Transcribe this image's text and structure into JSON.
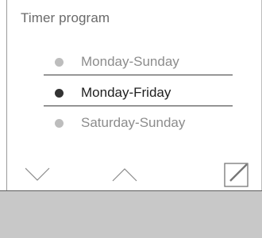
{
  "screen": {
    "title": "Timer program"
  },
  "options": [
    {
      "label": "Monday-Sunday",
      "selected": false
    },
    {
      "label": "Monday-Friday",
      "selected": true
    },
    {
      "label": "Saturday-Sunday",
      "selected": false
    }
  ],
  "controls": {
    "down_icon": "chevron-down-icon",
    "up_icon": "chevron-up-icon",
    "edit_icon": "edit-icon"
  },
  "colors": {
    "selected_text": "#1e1e1e",
    "unselected_text": "#8c8c8c",
    "selected_dot": "#333333",
    "unselected_dot": "#bdbdbd",
    "bottom_bar": "#c8c8c8"
  }
}
